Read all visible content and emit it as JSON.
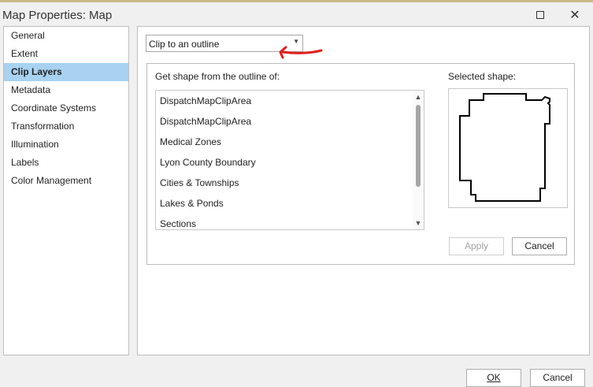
{
  "window": {
    "title": "Map Properties: Map"
  },
  "nav": {
    "items": [
      {
        "label": "General"
      },
      {
        "label": "Extent"
      },
      {
        "label": "Clip Layers"
      },
      {
        "label": "Metadata"
      },
      {
        "label": "Coordinate Systems"
      },
      {
        "label": "Transformation"
      },
      {
        "label": "Illumination"
      },
      {
        "label": "Labels"
      },
      {
        "label": "Color Management"
      }
    ],
    "selected": "Clip Layers"
  },
  "clip": {
    "mode_value": "Clip to an outline",
    "list_label": "Get shape from the outline of:",
    "layers": [
      "DispatchMapClipArea",
      "DispatchMapClipArea",
      "Medical Zones",
      "Lyon County Boundary",
      "Cities & Townships",
      "Lakes & Ponds",
      "Sections"
    ],
    "shape_label": "Selected shape:",
    "apply_label": "Apply",
    "cancel_label": "Cancel"
  },
  "footer": {
    "ok_label": "OK",
    "cancel_label": "Cancel"
  },
  "colors": {
    "selection": "#a8d2f0",
    "annotation": "#e0201c"
  },
  "icons": {
    "maximize": "maximize-icon",
    "close": "close-icon",
    "dropdown": "chevron-down-icon"
  }
}
